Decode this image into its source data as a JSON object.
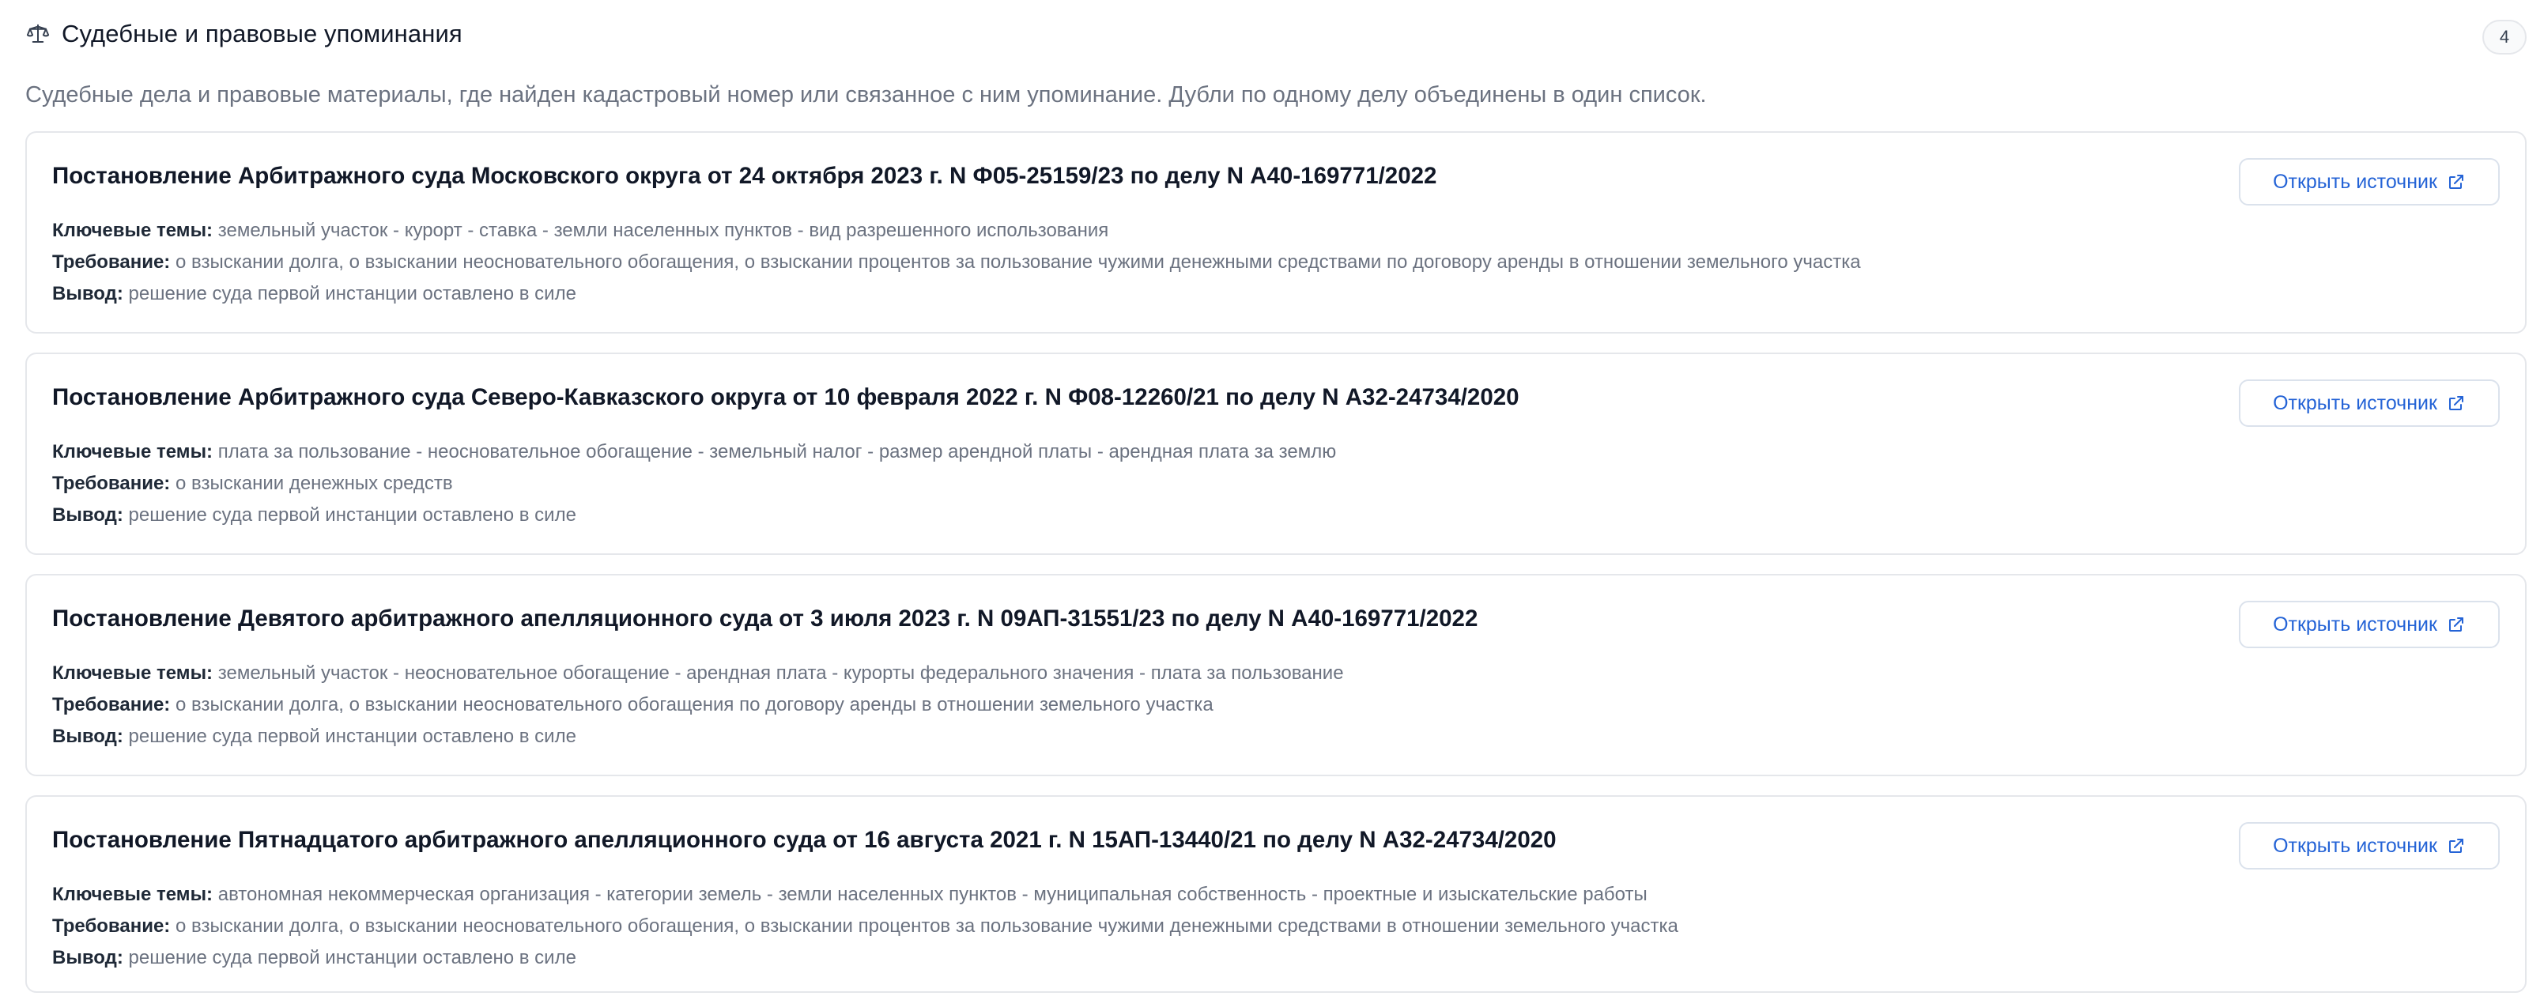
{
  "section": {
    "icon": "scale-icon",
    "title": "Судебные и правовые упоминания",
    "count": "4",
    "subtitle": "Судебные дела и правовые материалы, где найден кадастровый номер или связанное с ним упоминание. Дубли по одному делу объединены в один список."
  },
  "labels": {
    "topics": "Ключевые темы:",
    "claim": "Требование:",
    "conclusion": "Вывод:",
    "open_source": "Открыть источник"
  },
  "cases": [
    {
      "title": "Постановление Арбитражного суда Московского округа от 24 октября 2023 г. N Ф05-25159/23 по делу N А40-169771/2022",
      "topics": "земельный участок - курорт - ставка - земли населенных пунктов - вид разрешенного использования",
      "claim": "о взыскании долга, о взыскании неосновательного обогащения, о взыскании процентов за пользование чужими денежными средствами по договору аренды в отношении земельного участка",
      "conclusion": "решение суда первой инстанции оставлено в силе"
    },
    {
      "title": "Постановление Арбитражного суда Северо-Кавказского округа от 10 февраля 2022 г. N Ф08-12260/21 по делу N А32-24734/2020",
      "topics": "плата за пользование - неосновательное обогащение - земельный налог - размер арендной платы - арендная плата за землю",
      "claim": "о взыскании денежных средств",
      "conclusion": "решение суда первой инстанции оставлено в силе"
    },
    {
      "title": "Постановление Девятого арбитражного апелляционного суда от 3 июля 2023 г. N 09АП-31551/23 по делу N А40-169771/2022",
      "topics": "земельный участок - неосновательное обогащение - арендная плата - курорты федерального значения - плата за пользование",
      "claim": "о взыскании долга, о взыскании неосновательного обогащения по договору аренды в отношении земельного участка",
      "conclusion": "решение суда первой инстанции оставлено в силе"
    },
    {
      "title": "Постановление Пятнадцатого арбитражного апелляционного суда от 16 августа 2021 г. N 15АП-13440/21 по делу N А32-24734/2020",
      "topics": "автономная некоммерческая организация - категории земель - земли населенных пунктов - муниципальная собственность - проектные и изыскательские работы",
      "claim": "о взыскании долга, о взыскании неосновательного обогащения, о взыскании процентов за пользование чужими денежными средствами в отношении земельного участка",
      "conclusion": "решение суда первой инстанции оставлено в силе"
    }
  ],
  "colors": {
    "accent": "#2463d6",
    "border": "#e5e7eb",
    "muted_text": "#6b7280"
  }
}
